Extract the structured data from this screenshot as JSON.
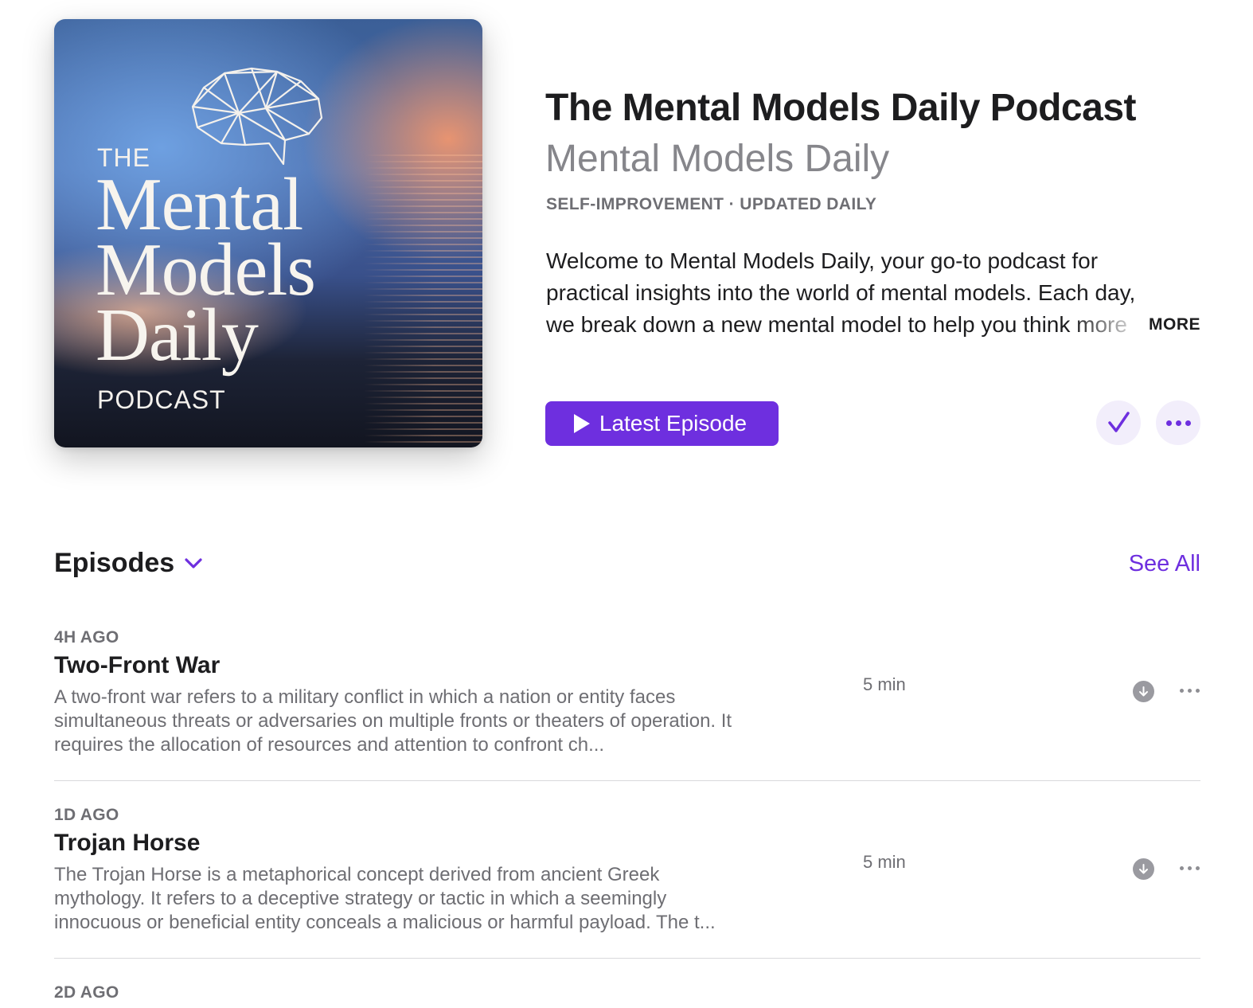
{
  "artwork": {
    "the": "THE",
    "title_lines": [
      "Mental",
      "Models",
      "Daily"
    ],
    "podcast": "PODCAST"
  },
  "show": {
    "title": "The Mental Models Daily Podcast",
    "author": "Mental Models Daily",
    "meta": "SELF-IMPROVEMENT · UPDATED DAILY",
    "description_lines": [
      "Welcome to Mental Models Daily, your go-to podcast for",
      "practical insights into the world of mental models. Each day,",
      "we break down a new mental model to help you think more"
    ],
    "more_label": "MORE"
  },
  "actions": {
    "latest_label": "Latest Episode",
    "accent_color": "#6e2fdf"
  },
  "episodes": {
    "header": "Episodes",
    "see_all": "See All",
    "items": [
      {
        "age": "4H AGO",
        "title": "Two-Front War",
        "description": "A two-front war refers to a military conflict in which a nation or entity faces simultaneous threats or adversaries on multiple fronts or theaters of operation. It requires the allocation of resources and attention to confront ch...",
        "duration": "5 min"
      },
      {
        "age": "1D AGO",
        "title": "Trojan Horse",
        "description": "The Trojan Horse is a metaphorical concept derived from ancient Greek mythology. It refers to a deceptive strategy or tactic in which a seemingly innocuous or beneficial entity conceals a malicious or harmful payload. The t...",
        "duration": "5 min"
      },
      {
        "age": "2D AGO"
      }
    ]
  }
}
